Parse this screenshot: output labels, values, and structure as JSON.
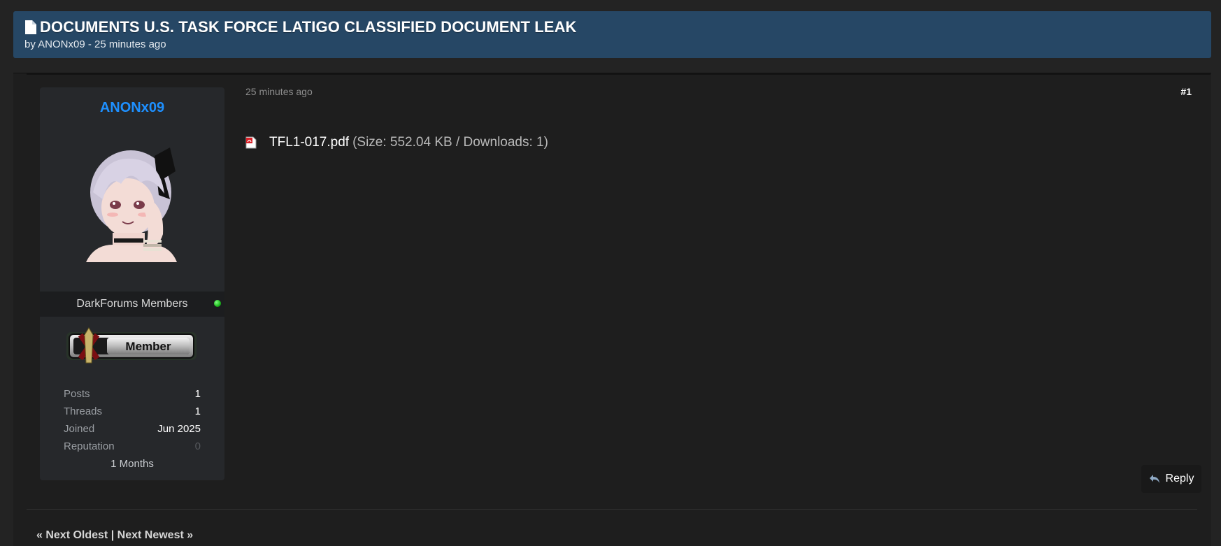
{
  "thread": {
    "title": "DOCUMENTS U.S. TASK FORCE LATIGO CLASSIFIED DOCUMENT LEAK",
    "meta": "by ANONx09 - 25 minutes ago",
    "title_icon": "document-icon"
  },
  "author": {
    "username": "ANONx09",
    "usergroup": "DarkForums Members",
    "status": "online",
    "rank_badge": "Member",
    "stats": [
      {
        "label": "Posts",
        "value": "1"
      },
      {
        "label": "Threads",
        "value": "1"
      },
      {
        "label": "Joined",
        "value": "Jun 2025"
      },
      {
        "label": "Reputation",
        "value": "0"
      }
    ],
    "tenure": "1 Months"
  },
  "post": {
    "date": "25 minutes ago",
    "number": "#1",
    "attachment": {
      "filename": "TFL1-017.pdf",
      "meta": "(Size: 552.04 KB / Downloads: 1)",
      "icon": "pdf-icon"
    },
    "reply_label": "Reply"
  },
  "nav": {
    "oldest": "« Next Oldest",
    "separator": "|",
    "newest": "Next Newest »"
  },
  "colors": {
    "header_bg": "#264765",
    "username": "#1e90ff",
    "online": "#1cb81c"
  }
}
